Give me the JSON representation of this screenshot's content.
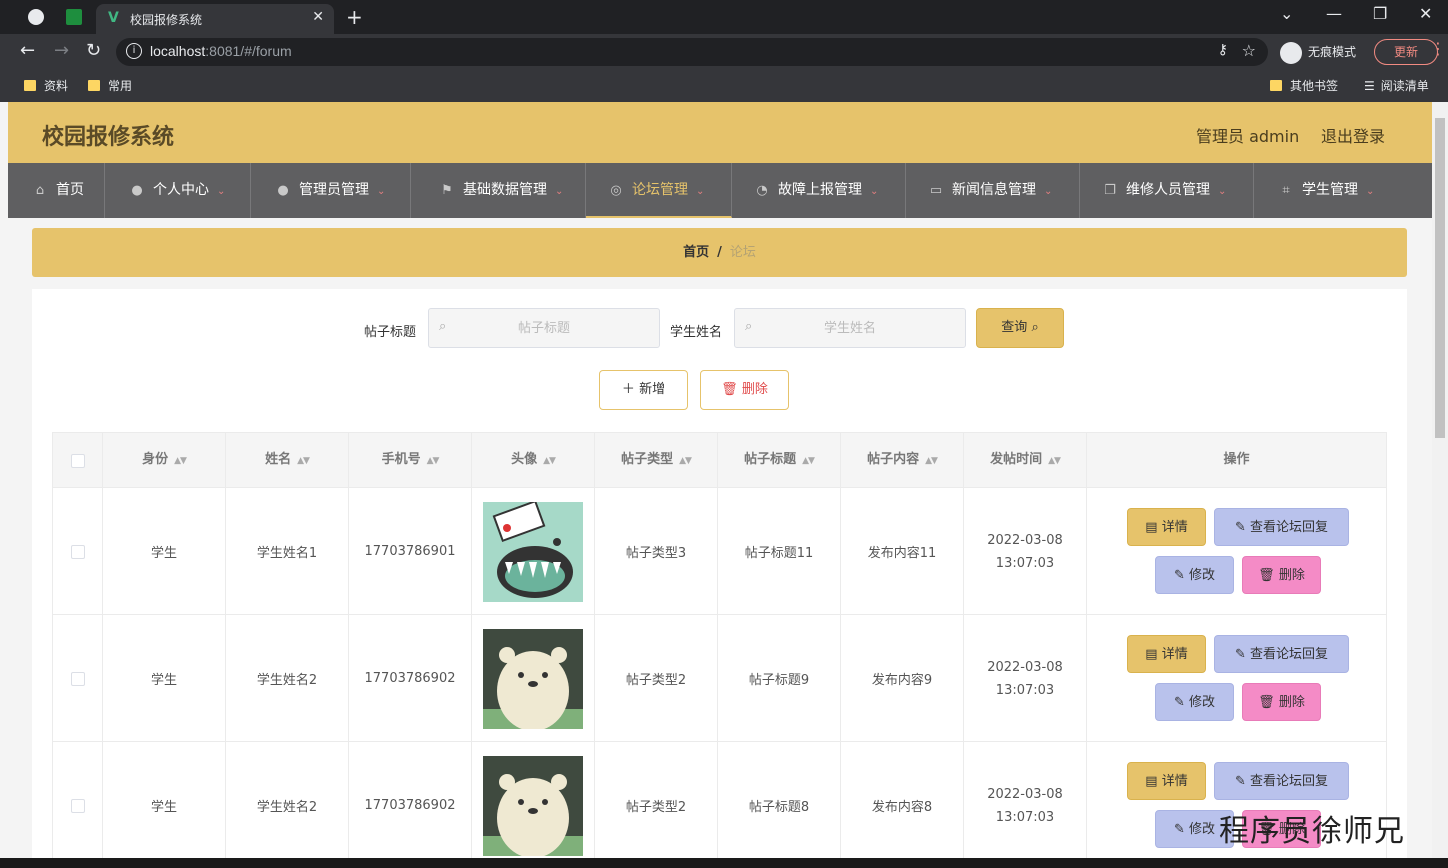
{
  "browser": {
    "tab_title": "校园报修系统",
    "url_host": "localhost",
    "url_rest": ":8081/#/forum",
    "incognito_label": "无痕模式",
    "update_label": "更新",
    "bookmarks": [
      "资料",
      "常用"
    ],
    "bookmarks_right": [
      "其他书签",
      "阅读清单"
    ]
  },
  "header": {
    "title": "校园报修系统",
    "user": "管理员 admin",
    "logout": "退出登录"
  },
  "menu": [
    {
      "label": "首页",
      "icon": "home-icon"
    },
    {
      "label": "个人中心",
      "icon": "user-icon"
    },
    {
      "label": "管理员管理",
      "icon": "user-icon"
    },
    {
      "label": "基础数据管理",
      "icon": "flag-icon"
    },
    {
      "label": "论坛管理",
      "icon": "globe-icon"
    },
    {
      "label": "故障上报管理",
      "icon": "gauge-icon"
    },
    {
      "label": "新闻信息管理",
      "icon": "chat-icon"
    },
    {
      "label": "维修人员管理",
      "icon": "copy-icon"
    },
    {
      "label": "学生管理",
      "icon": "crop-icon"
    }
  ],
  "breadcrumb": {
    "home": "首页",
    "sep": "/",
    "current": "论坛"
  },
  "search": {
    "title_label": "帖子标题",
    "title_placeholder": "帖子标题",
    "name_label": "学生姓名",
    "name_placeholder": "学生姓名",
    "query_label": "查询"
  },
  "actions": {
    "add_label": "新增",
    "delete_label": "删除"
  },
  "table": {
    "columns": [
      "身份",
      "姓名",
      "手机号",
      "头像",
      "帖子类型",
      "帖子标题",
      "帖子内容",
      "发帖时间",
      "操作"
    ],
    "rows": [
      {
        "role": "学生",
        "name": "学生姓名1",
        "phone": "17703786901",
        "type": "帖子类型3",
        "title": "帖子标题11",
        "content": "发布内容11",
        "time": "2022-03-08 13:07:03"
      },
      {
        "role": "学生",
        "name": "学生姓名2",
        "phone": "17703786902",
        "type": "帖子类型2",
        "title": "帖子标题9",
        "content": "发布内容9",
        "time": "2022-03-08 13:07:03"
      },
      {
        "role": "学生",
        "name": "学生姓名2",
        "phone": "17703786902",
        "type": "帖子类型2",
        "title": "帖子标题8",
        "content": "发布内容8",
        "time": "2022-03-08 13:07:03"
      }
    ],
    "row_buttons": {
      "detail": "详情",
      "reply": "查看论坛回复",
      "edit": "修改",
      "remove": "删除"
    }
  },
  "watermark": "程序员徐师兄"
}
